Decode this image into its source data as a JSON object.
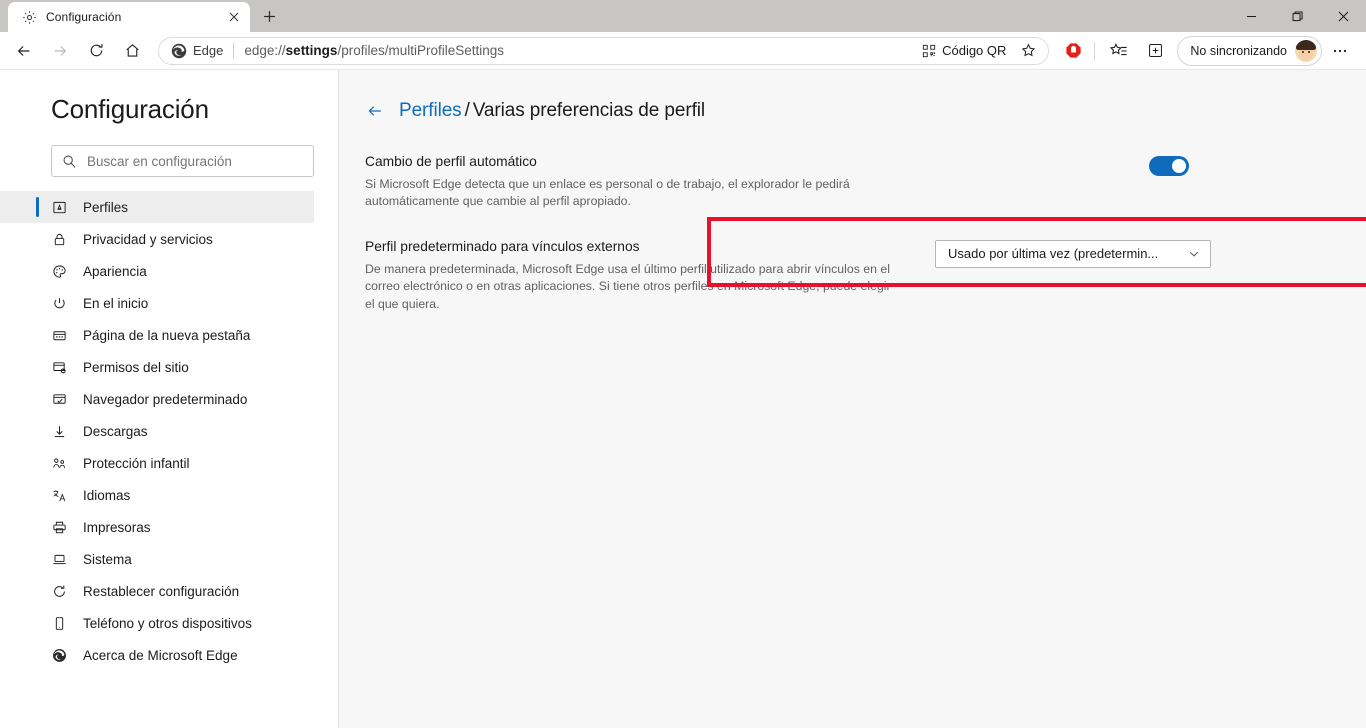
{
  "window": {
    "tab": {
      "title": "Configuración",
      "favicon": "gear-icon",
      "close_label": "×"
    },
    "new_tab_label": "+",
    "controls": {
      "minimize": "minimize-icon",
      "maximize": "maximize-icon",
      "close": "close-icon"
    }
  },
  "toolbar": {
    "back": "back-arrow-icon",
    "forward": "forward-arrow-icon",
    "refresh": "refresh-icon",
    "home": "home-icon",
    "omnibox": {
      "brand": "Edge",
      "url_prefix": "edge://",
      "url_bold": "settings",
      "url_suffix": "/profiles/multiProfileSettings",
      "url_full": "edge://settings/profiles/multiProfileSettings",
      "qr_label": "Código QR",
      "favorite": "star-icon"
    },
    "extension": "adblock-icon",
    "collections": "collections-icon",
    "favorites": "favorites-list-icon",
    "sync_label": "No sincronizando",
    "more": "ellipsis-icon"
  },
  "sidebar": {
    "title": "Configuración",
    "search": {
      "placeholder": "Buscar en configuración",
      "value": ""
    },
    "items": [
      {
        "label": "Perfiles",
        "icon": "profile-card-icon",
        "active": true
      },
      {
        "label": "Privacidad y servicios",
        "icon": "lock-icon",
        "active": false
      },
      {
        "label": "Apariencia",
        "icon": "palette-icon",
        "active": false
      },
      {
        "label": "En el inicio",
        "icon": "power-icon",
        "active": false
      },
      {
        "label": "Página de la nueva pestaña",
        "icon": "new-tab-page-icon",
        "active": false
      },
      {
        "label": "Permisos del sitio",
        "icon": "site-permissions-icon",
        "active": false
      },
      {
        "label": "Navegador predeterminado",
        "icon": "default-browser-icon",
        "active": false
      },
      {
        "label": "Descargas",
        "icon": "download-arrow-icon",
        "active": false
      },
      {
        "label": "Protección infantil",
        "icon": "family-icon",
        "active": false
      },
      {
        "label": "Idiomas",
        "icon": "languages-icon",
        "active": false
      },
      {
        "label": "Impresoras",
        "icon": "printer-icon",
        "active": false
      },
      {
        "label": "Sistema",
        "icon": "laptop-icon",
        "active": false
      },
      {
        "label": "Restablecer configuración",
        "icon": "reset-icon",
        "active": false
      },
      {
        "label": "Teléfono y otros dispositivos",
        "icon": "phone-icon",
        "active": false
      },
      {
        "label": "Acerca de Microsoft Edge",
        "icon": "edge-logo-icon",
        "active": false
      }
    ]
  },
  "main": {
    "breadcrumb": {
      "parent": "Perfiles",
      "separator": "/",
      "current": "Varias preferencias de perfil"
    },
    "auto_switch": {
      "title": "Cambio de perfil automático",
      "description": "Si Microsoft Edge detecta que un enlace es personal o de trabajo, el explorador le pedirá automáticamente que cambie al perfil apropiado.",
      "toggle_on": true
    },
    "default_profile": {
      "title": "Perfil predeterminado para vínculos externos",
      "description": "De manera predeterminada, Microsoft Edge usa el último perfil utilizado para abrir vínculos en el correo electrónico o en otras aplicaciones. Si tiene otros perfiles en Microsoft Edge, puede elegir el que quiera.",
      "select_value": "Usado por última vez (predetermin...",
      "select_chevron": "chevron-down-icon"
    }
  },
  "annotation": {
    "highlight_color": "#e8112d"
  },
  "colors": {
    "accent": "#0f6cbd",
    "toggle_on": "#0f6cbd",
    "highlight": "#e8112d",
    "content_bg": "#f7f7f7"
  }
}
